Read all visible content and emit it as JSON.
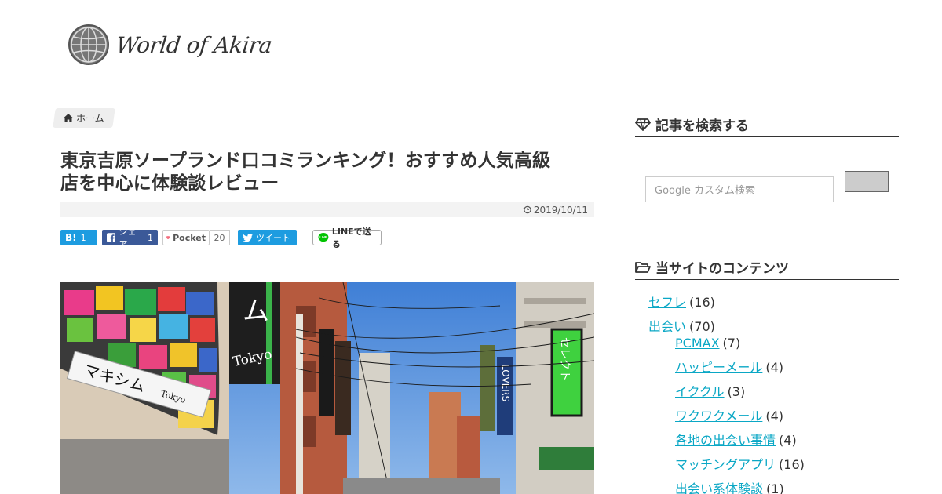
{
  "header": {
    "logo_text": "World of Akira"
  },
  "breadcrumb": {
    "home_label": "ホーム"
  },
  "post": {
    "title_line1": "東京吉原ソープランド口コミランキング！おすすめ人気高級",
    "title_line2": "店を中心に体験談レビュー",
    "date": "2019/10/11"
  },
  "share": {
    "hatena_label": "B!",
    "hatena_count": "1",
    "facebook_label": "シェア",
    "facebook_count": "1",
    "pocket_label": "Pocket",
    "pocket_count": "20",
    "twitter_label": "ツイート",
    "line_label": "LINEで送る"
  },
  "photo": {
    "sign_maxim": "マキシム",
    "sign_tokyo": "Tokyo",
    "sign_mu": "ム",
    "sign_select": "セレクト",
    "sign_lovers": "LOVERS"
  },
  "sidebar": {
    "search_title": "記事を検索する",
    "search_placeholder": "Google カスタム検索",
    "contents_title": "当サイトのコンテンツ",
    "categories": [
      {
        "label": "セフレ",
        "count": "(16)"
      },
      {
        "label": "出会い",
        "count": "(70)"
      },
      {
        "label": "PCMAX",
        "count": "(7)"
      },
      {
        "label": "ハッピーメール",
        "count": "(4)"
      },
      {
        "label": "イククル",
        "count": "(3)"
      },
      {
        "label": "ワクワクメール",
        "count": "(4)"
      },
      {
        "label": "各地の出会い事情",
        "count": "(4)"
      },
      {
        "label": "マッチングアプリ",
        "count": "(16)"
      },
      {
        "label": "出会い系体験談",
        "count": "(1)"
      }
    ]
  },
  "colors": {
    "link": "#0aa7c5",
    "hatena": "#1d9ce0",
    "facebook": "#3b5998",
    "twitter": "#1d9ce0"
  }
}
